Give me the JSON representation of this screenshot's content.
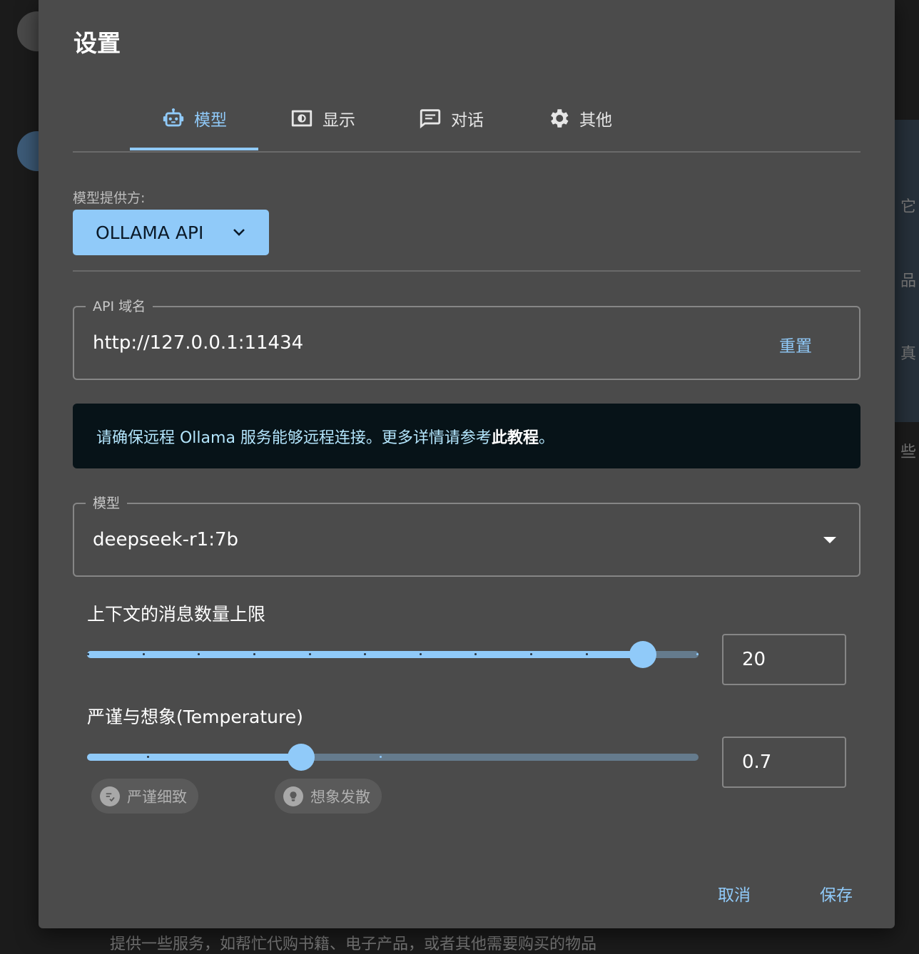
{
  "dialog": {
    "title": "设置"
  },
  "tabs": [
    {
      "label": "模型",
      "icon": "robot-icon",
      "active": true
    },
    {
      "label": "显示",
      "icon": "display-icon",
      "active": false
    },
    {
      "label": "对话",
      "icon": "chat-icon",
      "active": false
    },
    {
      "label": "其他",
      "icon": "gear-icon",
      "active": false
    }
  ],
  "provider": {
    "label": "模型提供方:",
    "value": "OLLAMA API"
  },
  "api_host": {
    "label": "API 域名",
    "value": "http://127.0.0.1:11434",
    "reset_label": "重置"
  },
  "alert": {
    "text": "请确保远程 Ollama 服务能够远程连接。更多详情请参考",
    "link": "此教程",
    "suffix": "。"
  },
  "model": {
    "label": "模型",
    "value": "deepseek-r1:7b"
  },
  "context_limit": {
    "title": "上下文的消息数量上限",
    "value": "20",
    "fraction": 0.909,
    "marks": 12
  },
  "temperature": {
    "title": "严谨与想象(Temperature)",
    "value": "0.7",
    "fraction": 0.35,
    "chips": [
      {
        "label": "严谨细致",
        "icon": "checklist-icon"
      },
      {
        "label": "想象发散",
        "icon": "lightbulb-icon"
      }
    ]
  },
  "actions": {
    "cancel": "取消",
    "save": "保存"
  },
  "background": {
    "side_texts": [
      "它",
      "品",
      "真",
      "些"
    ],
    "bottom_text": "提供一些服务，如帮忙代购书籍、电子产品，或者其他需要购买的物品"
  },
  "colors": {
    "accent": "#90caf9",
    "dialog_bg": "#4b4b4b",
    "alert_bg": "#071318"
  }
}
